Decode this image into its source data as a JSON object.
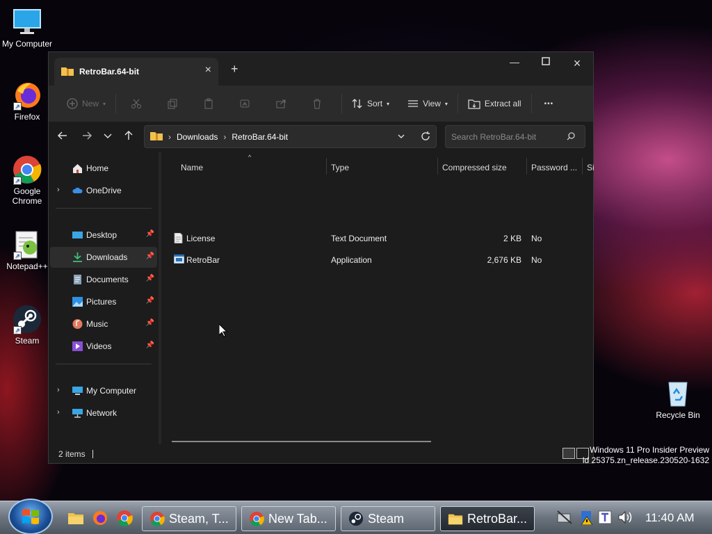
{
  "desktop": {
    "icons": [
      "My Computer",
      "Firefox",
      "Google Chrome",
      "Notepad++",
      "Steam",
      "Recycle Bin"
    ]
  },
  "window": {
    "tab_title": "RetroBar.64-bit",
    "toolbar": {
      "new": "New",
      "sort": "Sort",
      "view": "View",
      "extract_all": "Extract all",
      "more": "•••"
    },
    "address": {
      "segments": [
        "Downloads",
        "RetroBar.64-bit"
      ]
    },
    "search": {
      "placeholder": "Search RetroBar.64-bit"
    },
    "sidebar": {
      "home": "Home",
      "onedrive": "OneDrive",
      "desktop": "Desktop",
      "downloads": "Downloads",
      "documents": "Documents",
      "pictures": "Pictures",
      "music": "Music",
      "videos": "Videos",
      "my_computer": "My Computer",
      "network": "Network"
    },
    "columns": {
      "name": "Name",
      "type": "Type",
      "compressed_size": "Compressed size",
      "password": "Password ...",
      "size": "Si"
    },
    "files": [
      {
        "name": "License",
        "type": "Text Document",
        "compressed_size": "2 KB",
        "password": "No"
      },
      {
        "name": "RetroBar",
        "type": "Application",
        "compressed_size": "2,676 KB",
        "password": "No"
      }
    ],
    "status": {
      "items": "2 items"
    }
  },
  "watermark": {
    "line1": "Windows 11 Pro Insider Preview",
    "line2": "ld 25375.zn_release.230520-1632"
  },
  "taskbar": {
    "tasks": [
      "Steam, T...",
      "New Tab...",
      "Steam",
      "RetroBar..."
    ],
    "clock": "11:40 AM"
  }
}
